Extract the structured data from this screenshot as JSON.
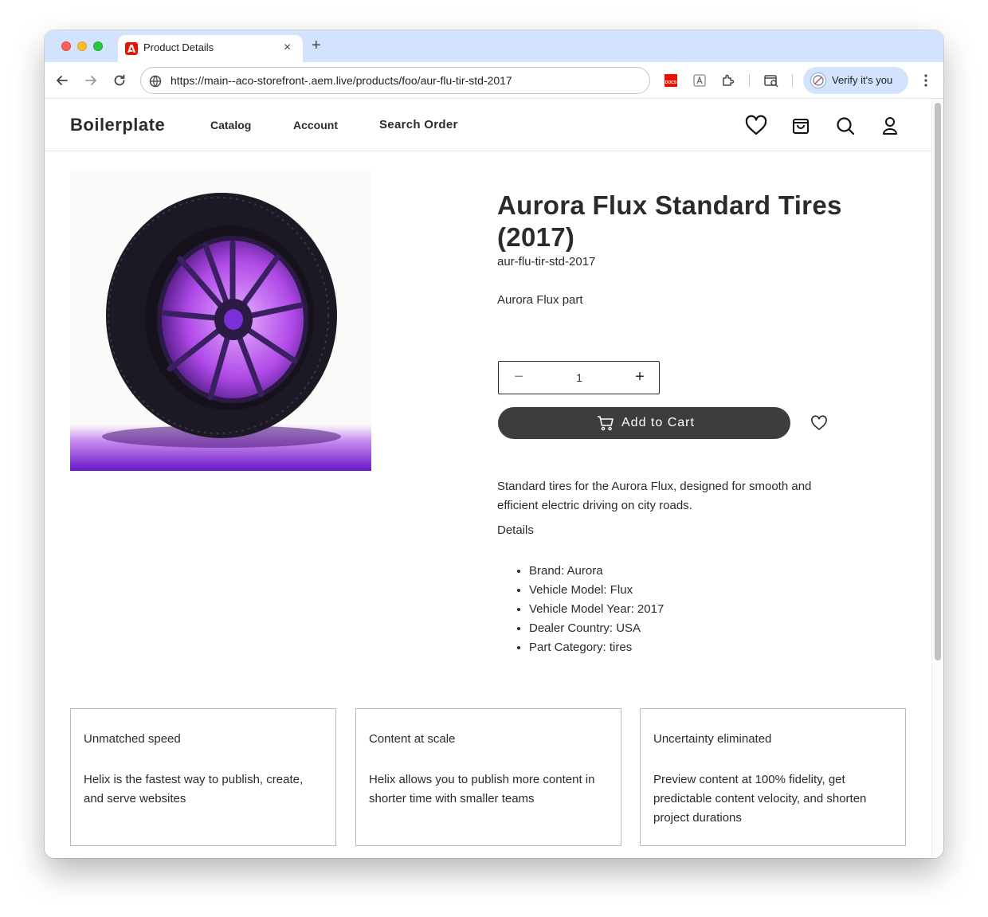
{
  "browser": {
    "tab_title": "Product Details",
    "tab_close": "×",
    "new_tab": "+",
    "url": "https://main--aco-storefront-.aem.live/products/foo/aur-flu-tir-std-2017",
    "docs_ext_label": "DOCS",
    "verify_label": "Verify it's you"
  },
  "site": {
    "brand": "Boilerplate",
    "nav": [
      "Catalog",
      "Account",
      "Search Order"
    ]
  },
  "product": {
    "title": "Aurora Flux Standard Tires (2017)",
    "sku": "aur-flu-tir-std-2017",
    "short_description": "Aurora Flux part",
    "quantity": "1",
    "add_to_cart": "Add to Cart",
    "description": "Standard tires for the Aurora Flux, designed for smooth and efficient electric driving on city roads.",
    "details_heading": "Details",
    "details": [
      "Brand: Aurora",
      "Vehicle Model: Flux",
      "Vehicle Model Year: 2017",
      "Dealer Country: USA",
      "Part Category: tires"
    ]
  },
  "features": [
    {
      "title": "Unmatched speed",
      "text": "Helix is the fastest way to publish, create, and serve websites"
    },
    {
      "title": "Content at scale",
      "text": "Helix allows you to publish more content in shorter time with smaller teams"
    },
    {
      "title": "Uncertainty eliminated",
      "text": "Preview content at 100% fidelity, get predictable content velocity, and shorten project durations"
    }
  ],
  "icons": {
    "wishlist": "heart-icon",
    "cart": "shopping-bag-icon",
    "search": "search-icon",
    "account": "user-icon"
  },
  "colors": {
    "button_bg": "#3d3d3d",
    "tab_strip": "#d3e3fd",
    "tire_accent": "#7b2fd6"
  }
}
